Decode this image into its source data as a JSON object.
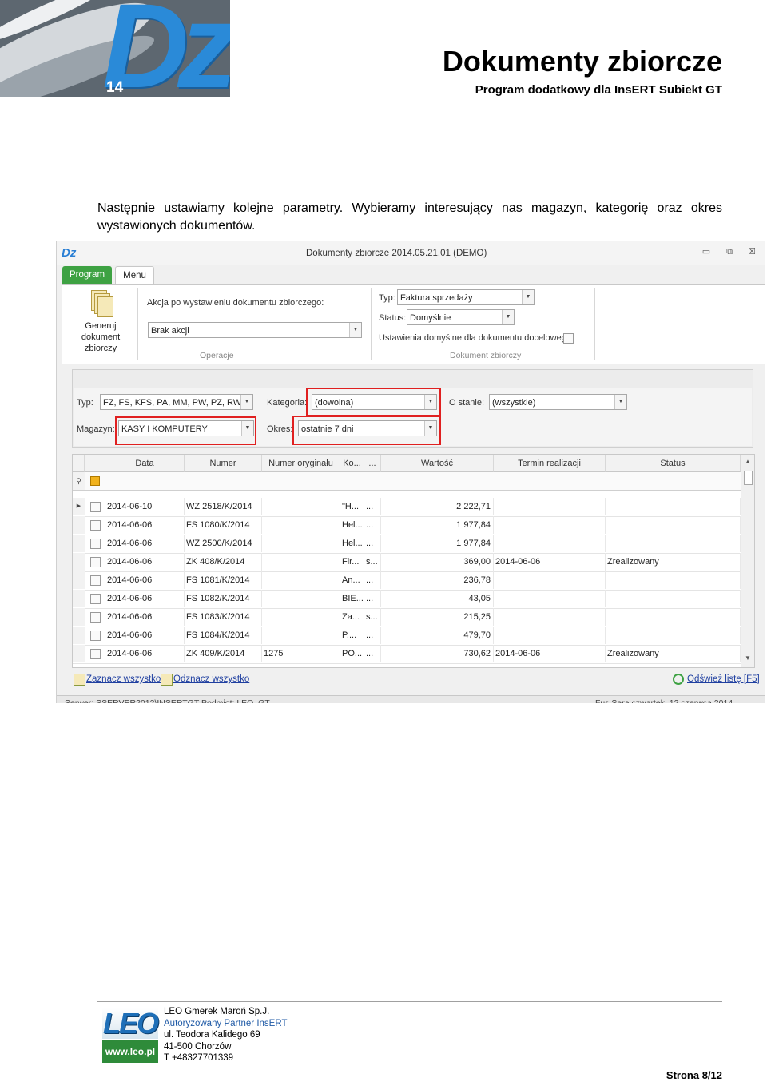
{
  "header": {
    "logo_text": "Dz",
    "logo_version": "14",
    "title": "Dokumenty zbiorcze",
    "subtitle": "Program dodatkowy dla InsERT Subiekt GT"
  },
  "intro_text": "Następnie ustawiamy kolejne parametry. Wybieramy interesujący nas magazyn, kategorię oraz okres wystawionych dokumentów.",
  "window": {
    "app_icon": "Dz",
    "title": "Dokumenty zbiorcze 2014.05.21.01 (DEMO)",
    "controls": {
      "minimize": "▭",
      "restore": "⧉",
      "close": "☒"
    },
    "tabs": {
      "program": "Program",
      "menu": "Menu"
    },
    "ribbon": {
      "generate_label": "Generuj dokument zbiorczy",
      "action_label": "Akcja po wystawieniu dokumentu zbiorczego:",
      "action_value": "Brak akcji",
      "operations_group": "Operacje",
      "type_label": "Typ:",
      "type_value": "Faktura sprzedaży",
      "status_label": "Status:",
      "status_value": "Domyślnie",
      "defaults_label": "Ustawienia domyślne dla dokumentu docelowego",
      "document_group": "Dokument zbiorczy"
    },
    "filters": {
      "typ_label": "Typ:",
      "typ_value": "FZ, FS, KFS, PA, MM, PW, PZ, RW, ...",
      "kategoria_label": "Kategoria:",
      "kategoria_value": "(dowolna)",
      "ostanie_label": "O stanie:",
      "ostanie_value": "(wszystkie)",
      "magazyn_label": "Magazyn:",
      "magazyn_value": "KASY I KOMPUTERY",
      "okres_label": "Okres:",
      "okres_value": "ostatnie 7 dni"
    },
    "grid": {
      "columns": [
        "Data",
        "Numer",
        "Numer oryginału",
        "Ko...",
        "...",
        "Wartość",
        "Termin realizacji",
        "Status"
      ],
      "rows": [
        [
          "2014-06-10",
          "WZ 2518/K/2014",
          "",
          "\"H...",
          "...",
          "2 222,71",
          "",
          ""
        ],
        [
          "2014-06-06",
          "FS 1080/K/2014",
          "",
          "Hel...",
          "...",
          "1 977,84",
          "",
          ""
        ],
        [
          "2014-06-06",
          "WZ 2500/K/2014",
          "",
          "Hel...",
          "...",
          "1 977,84",
          "",
          ""
        ],
        [
          "2014-06-06",
          "ZK 408/K/2014",
          "",
          "Fir...",
          "s...",
          "369,00",
          "2014-06-06",
          "Zrealizowany"
        ],
        [
          "2014-06-06",
          "FS 1081/K/2014",
          "",
          "An...",
          "...",
          "236,78",
          "",
          ""
        ],
        [
          "2014-06-06",
          "FS 1082/K/2014",
          "",
          "BIE...",
          "...",
          "43,05",
          "",
          ""
        ],
        [
          "2014-06-06",
          "FS 1083/K/2014",
          "",
          "Za...",
          "s...",
          "215,25",
          "",
          ""
        ],
        [
          "2014-06-06",
          "FS 1084/K/2014",
          "",
          "P....",
          "...",
          "479,70",
          "",
          ""
        ],
        [
          "2014-06-06",
          "ZK 409/K/2014",
          "1275",
          "PO...",
          "...",
          "730,62",
          "2014-06-06",
          "Zrealizowany"
        ]
      ]
    },
    "bottom": {
      "select_all": "Zaznacz wszystko",
      "deselect_all": "Odznacz wszystko",
      "refresh": "Odśwież listę [F5]"
    },
    "statusbar": {
      "left": "Serwer: SSERVER2012\\INSERTGT   Podmiot: LEO_GT",
      "right": "Fus Sara      czwartek, 12 czerwca 2014"
    }
  },
  "footer": {
    "logo_top": "LEO",
    "logo_bottom": "www.leo.pl",
    "company": "LEO Gmerek Maroń Sp.J.",
    "partner": "Autoryzowany Partner InsERT",
    "street": "ul. Teodora Kalidego 69",
    "city": "41-500 Chorzów",
    "phone": "T +48327701339",
    "page": "Strona 8/12"
  },
  "colors": {
    "accent_green": "#3ea243",
    "highlight_red": "#e02020",
    "logo_blue": "#2a8ad8"
  }
}
